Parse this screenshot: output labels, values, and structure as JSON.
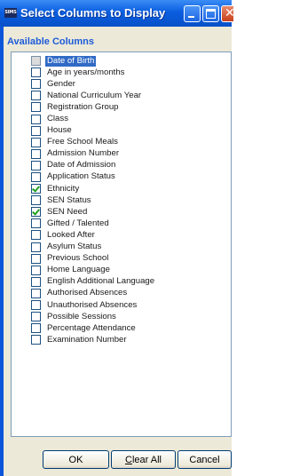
{
  "window": {
    "app_icon_text": "SIMS",
    "title": "Select Columns to Display"
  },
  "group": {
    "label": "Available Columns"
  },
  "columns": [
    {
      "label": "Date of Birth",
      "checked": false,
      "selected": true
    },
    {
      "label": "Age in years/months",
      "checked": false
    },
    {
      "label": "Gender",
      "checked": false
    },
    {
      "label": "National Curriculum Year",
      "checked": false
    },
    {
      "label": "Registration Group",
      "checked": false
    },
    {
      "label": "Class",
      "checked": false
    },
    {
      "label": "House",
      "checked": false
    },
    {
      "label": "Free School Meals",
      "checked": false
    },
    {
      "label": "Admission Number",
      "checked": false
    },
    {
      "label": "Date of Admission",
      "checked": false
    },
    {
      "label": "Application Status",
      "checked": false
    },
    {
      "label": "Ethnicity",
      "checked": true
    },
    {
      "label": "SEN Status",
      "checked": false
    },
    {
      "label": "SEN Need",
      "checked": true
    },
    {
      "label": "Gifted / Talented",
      "checked": false
    },
    {
      "label": "Looked After",
      "checked": false
    },
    {
      "label": "Asylum Status",
      "checked": false
    },
    {
      "label": "Previous School",
      "checked": false
    },
    {
      "label": "Home Language",
      "checked": false
    },
    {
      "label": "English Additional Language",
      "checked": false
    },
    {
      "label": "Authorised Absences",
      "checked": false
    },
    {
      "label": "Unauthorised Absences",
      "checked": false
    },
    {
      "label": "Possible Sessions",
      "checked": false
    },
    {
      "label": "Percentage Attendance",
      "checked": false
    },
    {
      "label": "Examination Number",
      "checked": false
    }
  ],
  "buttons": {
    "ok": "OK",
    "clear_all_accel": "C",
    "clear_all_rest": "lear All",
    "cancel": "Cancel"
  }
}
